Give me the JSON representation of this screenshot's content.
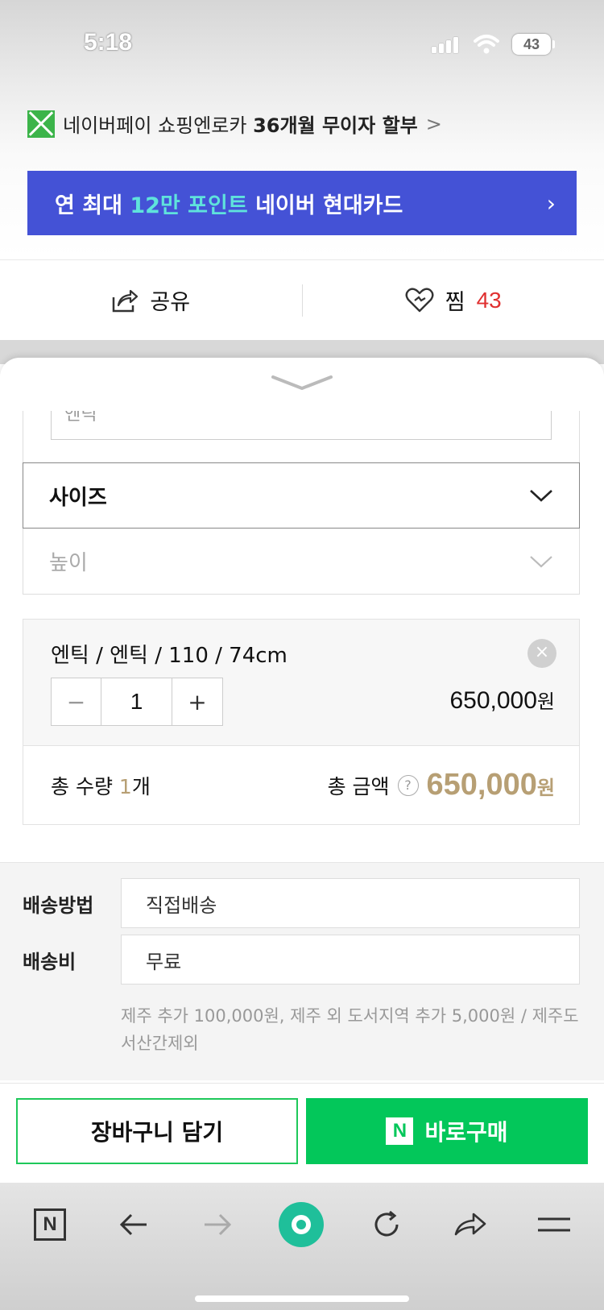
{
  "status_bar": {
    "time": "5:18",
    "battery": "43"
  },
  "promo": {
    "text": "네이버페이 쇼핑엔로카 ",
    "bold": "36개월 무이자 할부",
    "arrow": ">"
  },
  "banner": {
    "prefix": "연 최대 ",
    "highlight": "12만 포인트",
    "suffix": " 네이버 현대카드",
    "arrow": "›"
  },
  "actions": {
    "share_label": "공유",
    "wish_label": "찜",
    "wish_count": "43"
  },
  "options": {
    "partial_input_text": "엔틱",
    "size_label": "사이즈",
    "height_label": "높이"
  },
  "selected_item": {
    "name": "엔틱 / 엔틱 / 110 / 74cm",
    "remove_icon": "×",
    "minus": "−",
    "quantity": "1",
    "plus": "+",
    "price": "650,000",
    "currency": "원"
  },
  "total": {
    "qty_label": "총 수량 ",
    "qty_value": "1",
    "qty_unit": "개",
    "amount_label": "총 금액",
    "help": "?",
    "amount": "650,000",
    "currency": "원"
  },
  "shipping": {
    "method_label": "배송방법",
    "method_value": "직접배송",
    "fee_label": "배송비",
    "fee_value": "무료",
    "note": "제주 추가 100,000원, 제주 외 도서지역 추가 5,000원 / 제주도서산간제외"
  },
  "buttons": {
    "cart": "장바구니 담기",
    "buy_badge": "N",
    "buy": "바로구매"
  },
  "browser_nav": {
    "home_badge": "N"
  },
  "colors": {
    "naver_green": "#03c75a",
    "banner_blue": "#4452d6",
    "price_gold": "#b79f74",
    "wish_red": "#e03030"
  }
}
